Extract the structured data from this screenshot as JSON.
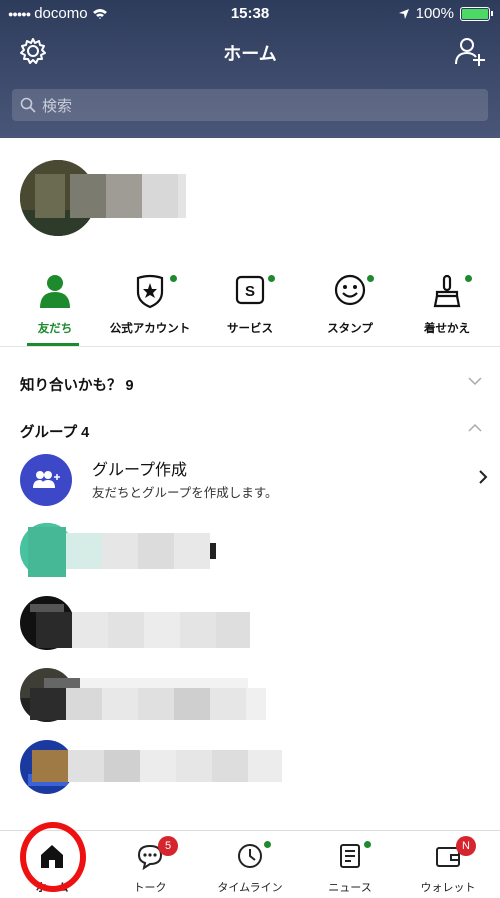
{
  "status_bar": {
    "carrier": "docomo",
    "time": "15:38",
    "battery": "100%"
  },
  "header": {
    "title": "ホーム",
    "search_placeholder": "検索"
  },
  "tabs": [
    {
      "label": "友だち",
      "icon": "person-icon",
      "active": true
    },
    {
      "label": "公式アカウント",
      "icon": "shield-star-icon"
    },
    {
      "label": "サービス",
      "icon": "s-box-icon"
    },
    {
      "label": "スタンプ",
      "icon": "smiley-icon"
    },
    {
      "label": "着せかえ",
      "icon": "brush-icon"
    }
  ],
  "sections": {
    "recommend": "知り合いかも？ 9",
    "groups": "グループ 4"
  },
  "group_create": {
    "title": "グループ作成",
    "subtitle": "友だちとグループを作成します。"
  },
  "bottom_nav": [
    {
      "label": "ホーム",
      "icon": "home-icon"
    },
    {
      "label": "トーク",
      "icon": "chat-icon",
      "badge": "5"
    },
    {
      "label": "タイムライン",
      "icon": "clock-icon"
    },
    {
      "label": "ニュース",
      "icon": "news-icon"
    },
    {
      "label": "ウォレット",
      "icon": "wallet-icon",
      "badge": "N"
    }
  ],
  "colors": {
    "accent": "#1e8a2e",
    "header": "#3a4668",
    "badge": "#d5262f",
    "highlight": "#ee1111"
  }
}
